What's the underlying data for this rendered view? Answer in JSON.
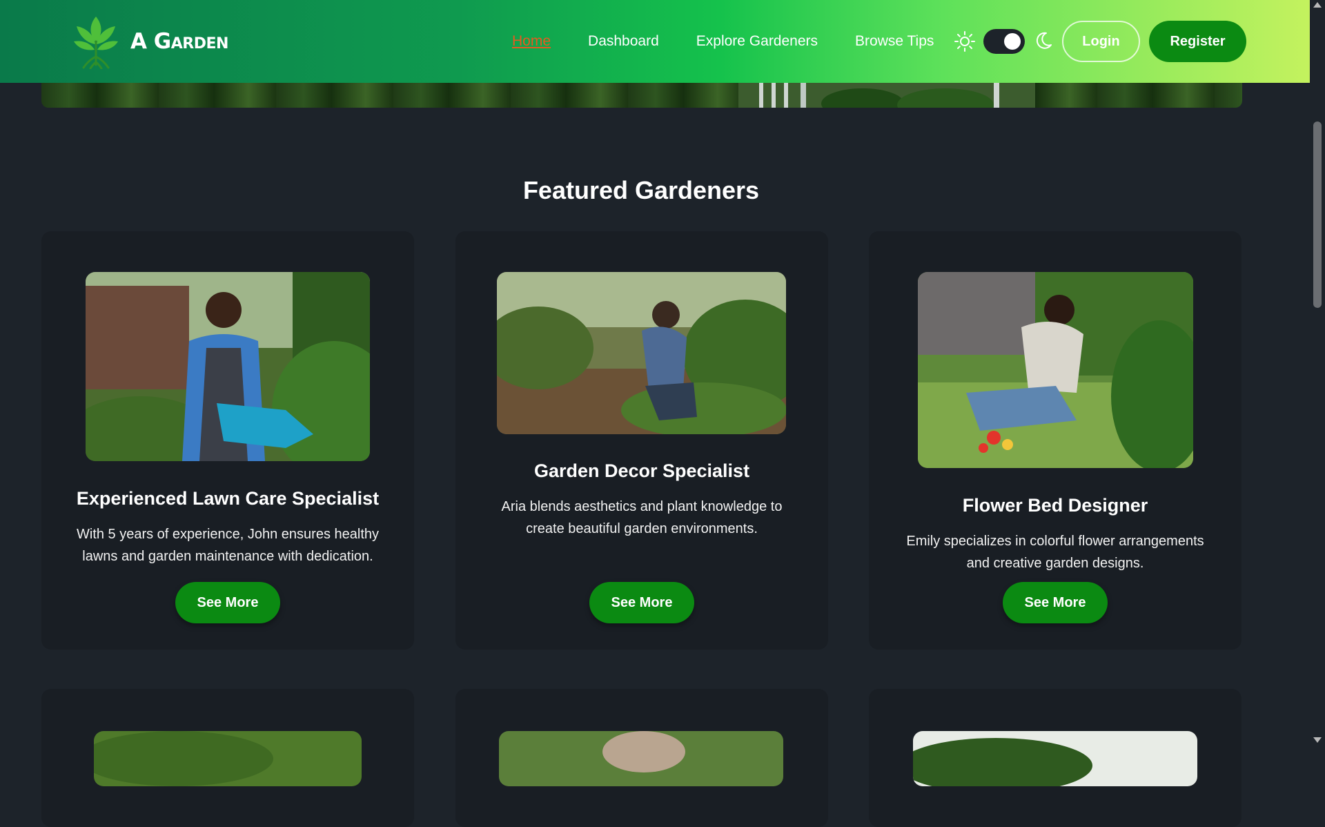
{
  "brand": {
    "name": "A Garden",
    "logo_icon": "leaf-tree-icon"
  },
  "nav": {
    "links": [
      {
        "label": "Home",
        "active": true
      },
      {
        "label": "Dashboard",
        "active": false
      },
      {
        "label": "Explore Gardeners",
        "active": false
      },
      {
        "label": "Browse Tips",
        "active": false
      }
    ],
    "theme_toggle": {
      "light_icon": "sun-icon",
      "dark_icon": "moon-icon",
      "state": "dark"
    },
    "login_label": "Login",
    "register_label": "Register"
  },
  "featured": {
    "title": "Featured Gardeners",
    "cards": [
      {
        "title": "Experienced Lawn Care Specialist",
        "description": "With 5 years of experience, John ensures healthy lawns and garden maintenance with dedication.",
        "button_label": "See More",
        "image_alt": "Smiling gardener in apron watering plants with a blue watering can"
      },
      {
        "title": "Garden Decor Specialist",
        "description": "Aria blends aesthetics and plant knowledge to create beautiful garden environments.",
        "button_label": "See More",
        "image_alt": "Bearded gardener kneeling and tending plants in a garden bed"
      },
      {
        "title": "Flower Bed Designer",
        "description": "Emily specializes in colorful flower arrangements and creative garden designs.",
        "button_label": "See More",
        "image_alt": "Gardener kneeling on grass planting colorful flowers"
      }
    ]
  },
  "colors": {
    "page_bg": "#1d232a",
    "card_bg": "#191e24",
    "button_green": "#0b8a12",
    "active_link": "#e8591f"
  }
}
